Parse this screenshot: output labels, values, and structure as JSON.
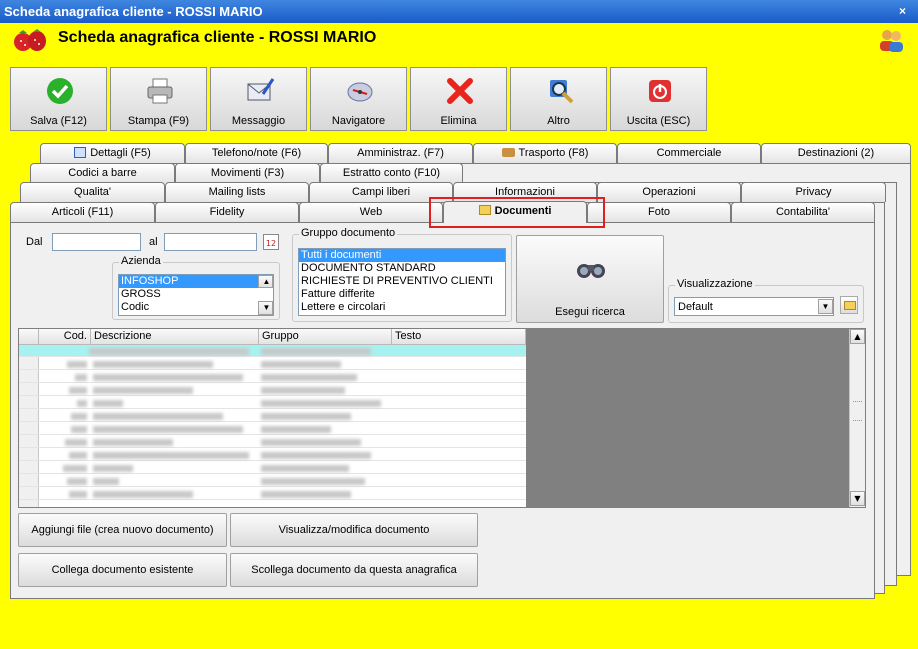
{
  "window": {
    "title": "Scheda anagrafica cliente - ROSSI MARIO",
    "close_glyph": "×"
  },
  "header": {
    "title": "Scheda anagrafica cliente - ROSSI MARIO"
  },
  "toolbar": [
    {
      "label": "Salva (F12)",
      "icon": "check-icon"
    },
    {
      "label": "Stampa (F9)",
      "icon": "printer-icon"
    },
    {
      "label": "Messaggio",
      "icon": "message-icon"
    },
    {
      "label": "Navigatore",
      "icon": "navigator-icon"
    },
    {
      "label": "Elimina",
      "icon": "delete-icon"
    },
    {
      "label": "Altro",
      "icon": "magnifier-icon"
    },
    {
      "label": "Uscita (ESC)",
      "icon": "exit-icon"
    }
  ],
  "tabs": {
    "row1": [
      "Dettagli (F5)",
      "Telefono/note (F6)",
      "Amministraz. (F7)",
      "Trasporto (F8)",
      "Commerciale",
      "Destinazioni (2)"
    ],
    "row2": [
      "Codici a barre",
      "Movimenti (F3)",
      "Estratto conto (F10)"
    ],
    "row3": [
      "Qualita'",
      "Mailing lists",
      "Campi liberi",
      "Informazioni",
      "Operazioni",
      "Privacy"
    ],
    "row4": [
      "Articoli (F11)",
      "Fidelity",
      "Web",
      "Documenti",
      "Foto",
      "Contabilita'"
    ]
  },
  "filters": {
    "dal_label": "Dal",
    "al_label": "al",
    "dal_value": "",
    "al_value": "",
    "calendar_day": "12",
    "azienda": {
      "title": "Azienda",
      "items": [
        "INFOSHOP",
        "GROSS",
        "Codic"
      ],
      "selected": 0
    },
    "gruppo": {
      "title": "Gruppo documento",
      "items": [
        "Tutti i documenti",
        "DOCUMENTO STANDARD",
        "RICHIESTE DI PREVENTIVO CLIENTI",
        "Fatture differite",
        "Lettere e circolari"
      ],
      "selected": 0
    },
    "search_button": "Esegui ricerca",
    "visualizzazione": {
      "title": "Visualizzazione",
      "value": "Default"
    }
  },
  "grid": {
    "columns": [
      "Cod.",
      "Descrizione",
      "Gruppo",
      "Testo"
    ]
  },
  "buttons": {
    "aggiungi": "Aggiungi file (crea nuovo documento)",
    "visualizza": "Visualizza/modifica documento",
    "collega": "Collega documento esistente",
    "scollega": "Scollega documento da questa anagrafica"
  },
  "colors": {
    "background": "#ffff00",
    "highlight": "#e02020",
    "selection": "#3399ff"
  }
}
